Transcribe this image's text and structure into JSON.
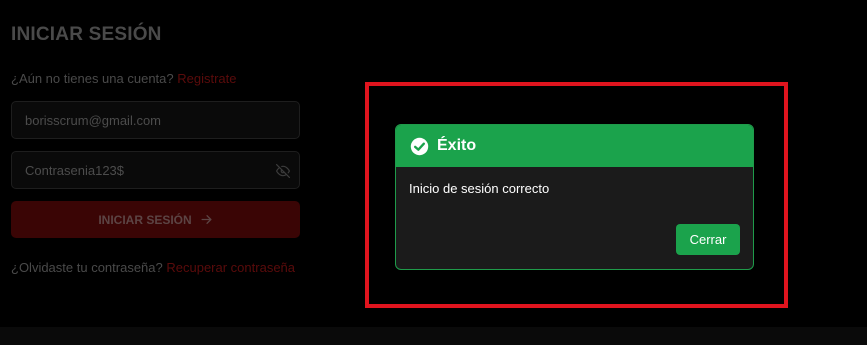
{
  "login": {
    "title": "INICIAR SESIÓN",
    "signup_prompt": "¿Aún no tienes una cuenta?",
    "signup_link": "Registrate",
    "email_value": "borisscrum@gmail.com",
    "password_value": "Contrasenia123$",
    "submit_label": "INICIAR SESIÓN",
    "forgot_prompt": "¿Olvidaste tu contraseña?",
    "forgot_link": "Recuperar contraseña",
    "icons": {
      "password_toggle": "eye-off-icon",
      "submit_arrow": "arrow-right-icon"
    }
  },
  "modal": {
    "title": "Éxito",
    "message": "Inicio de sesión correcto",
    "close_label": "Cerrar",
    "icon": "check-circle-icon"
  },
  "colors": {
    "success_green": "#1ba34c",
    "highlight_red": "#e0141e",
    "dimmed_button": "#3a0505",
    "dimmed_link": "#5a0b0b"
  }
}
